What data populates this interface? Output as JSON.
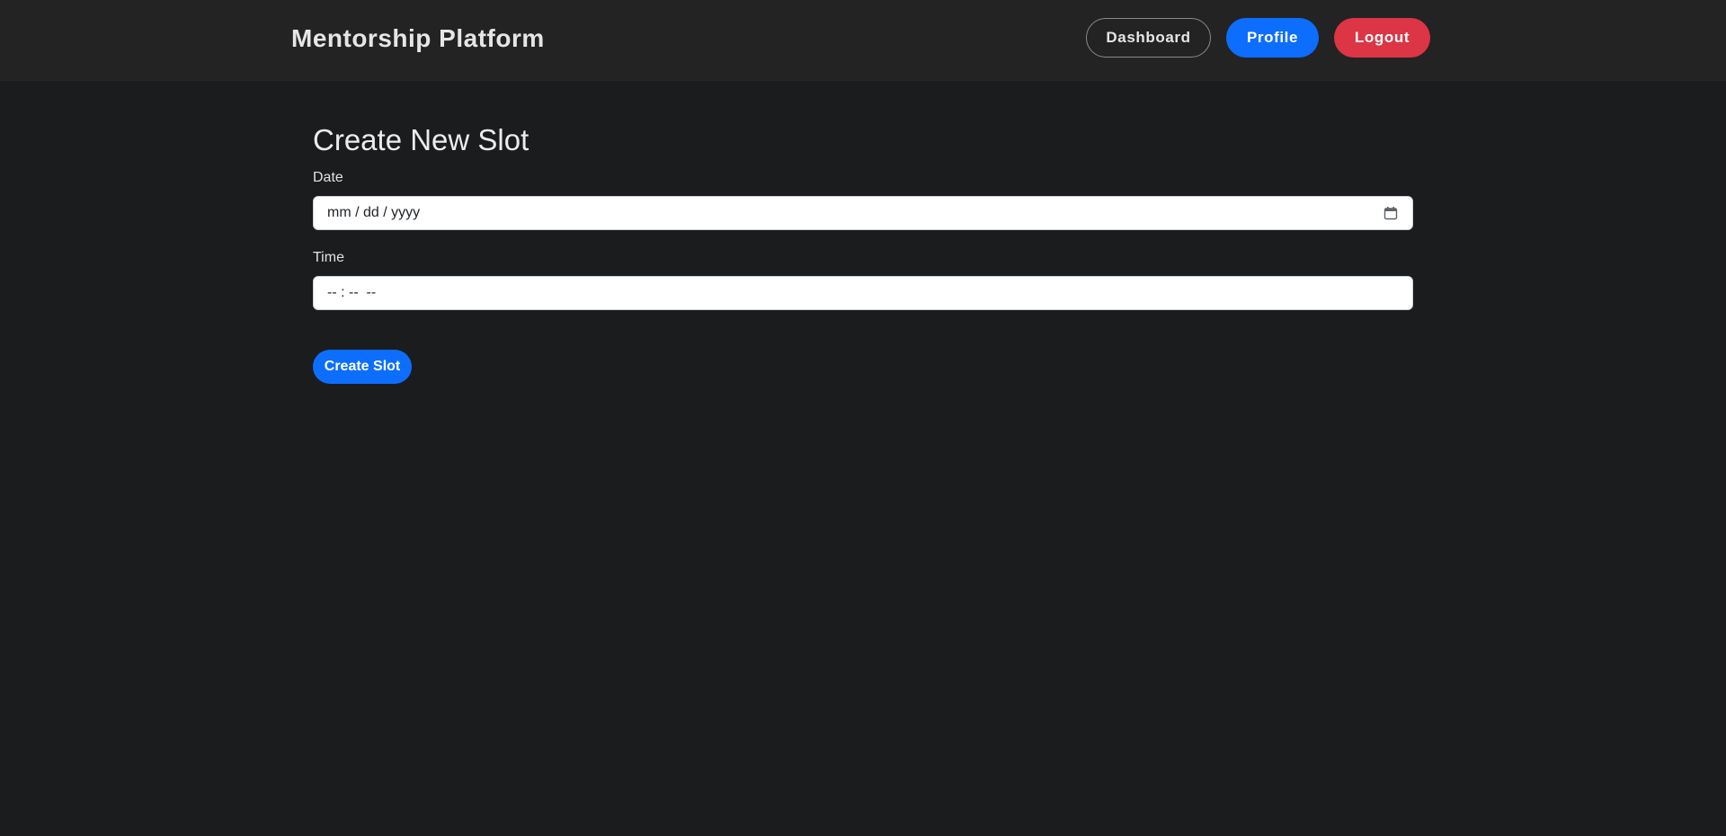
{
  "header": {
    "brand": "Mentorship Platform",
    "nav": {
      "dashboard": "Dashboard",
      "profile": "Profile",
      "logout": "Logout"
    }
  },
  "form": {
    "title": "Create New Slot",
    "date": {
      "label": "Date",
      "placeholder": "mm / dd / yyyy",
      "icon": "calendar-icon"
    },
    "time": {
      "label": "Time",
      "placeholder": "-- : --  --"
    },
    "submit_label": "Create Slot"
  },
  "colors": {
    "page_background": "#1b1c1e",
    "header_background": "#232323",
    "primary": "#0d6efd",
    "danger": "#dc3545"
  }
}
